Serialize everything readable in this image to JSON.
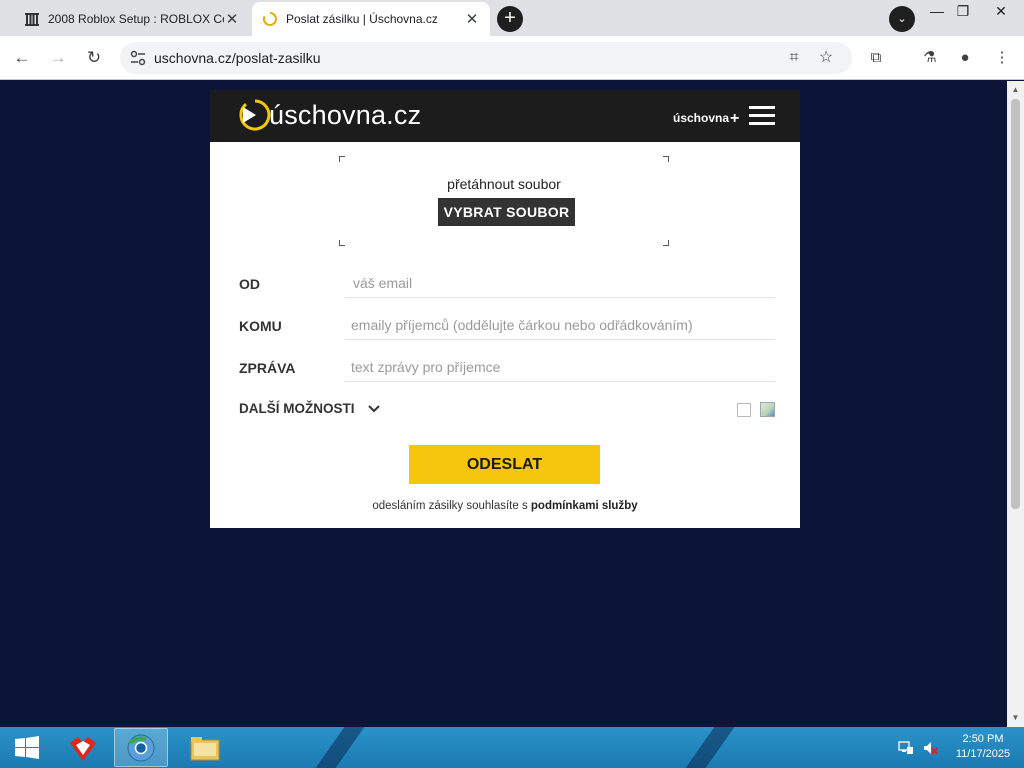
{
  "browser": {
    "tabs": [
      {
        "title": "2008 Roblox Setup : ROBLOX Co",
        "favicon": "archive-icon",
        "active": false
      },
      {
        "title": "Poslat zásilku | Úschovna.cz",
        "favicon": "loading-spinner-icon",
        "active": true
      }
    ],
    "new_tab_symbol": "+",
    "url": "uschovna.cz/poslat-zasilku",
    "nav_icons": [
      "back-arrow-icon",
      "forward-arrow-icon",
      "reload-icon"
    ],
    "toolbar_icons": [
      "translate-icon",
      "bookmark-star-icon",
      "extensions-icon",
      "labs-flask-icon",
      "profile-icon",
      "menu-kebab-icon"
    ]
  },
  "site": {
    "logo_text": "úschovna.cz",
    "plus_link": "úschovna",
    "plus_symbol": "+",
    "brand_accent": "#f5c60d",
    "header_bg": "#1c1c1c",
    "page_bg": "#0c1538"
  },
  "upload": {
    "drag_text": "přetáhnout soubor",
    "pick_button": "VYBRAT SOUBOR"
  },
  "form": {
    "from": {
      "label": "OD",
      "placeholder": "váš email",
      "value": ""
    },
    "to": {
      "label": "KOMU",
      "placeholder": "emaily příjemců (oddělujte čárkou nebo odřádkováním)",
      "value": ""
    },
    "message": {
      "label": "ZPRÁVA",
      "placeholder": "text zprávy pro příjemce",
      "value": ""
    },
    "more_options": "DALŠÍ MOŽNOSTI",
    "send_button": "ODESLAT",
    "terms_prefix": "odesláním zásilky souhlasíte s",
    "terms_link": "podmínkami služby"
  },
  "taskbar": {
    "time": "2:50 PM",
    "date": "11/17/2025",
    "items": [
      "start-windows-icon",
      "roblox-studio-icon",
      "chrome-browser-icon",
      "file-explorer-icon"
    ]
  }
}
